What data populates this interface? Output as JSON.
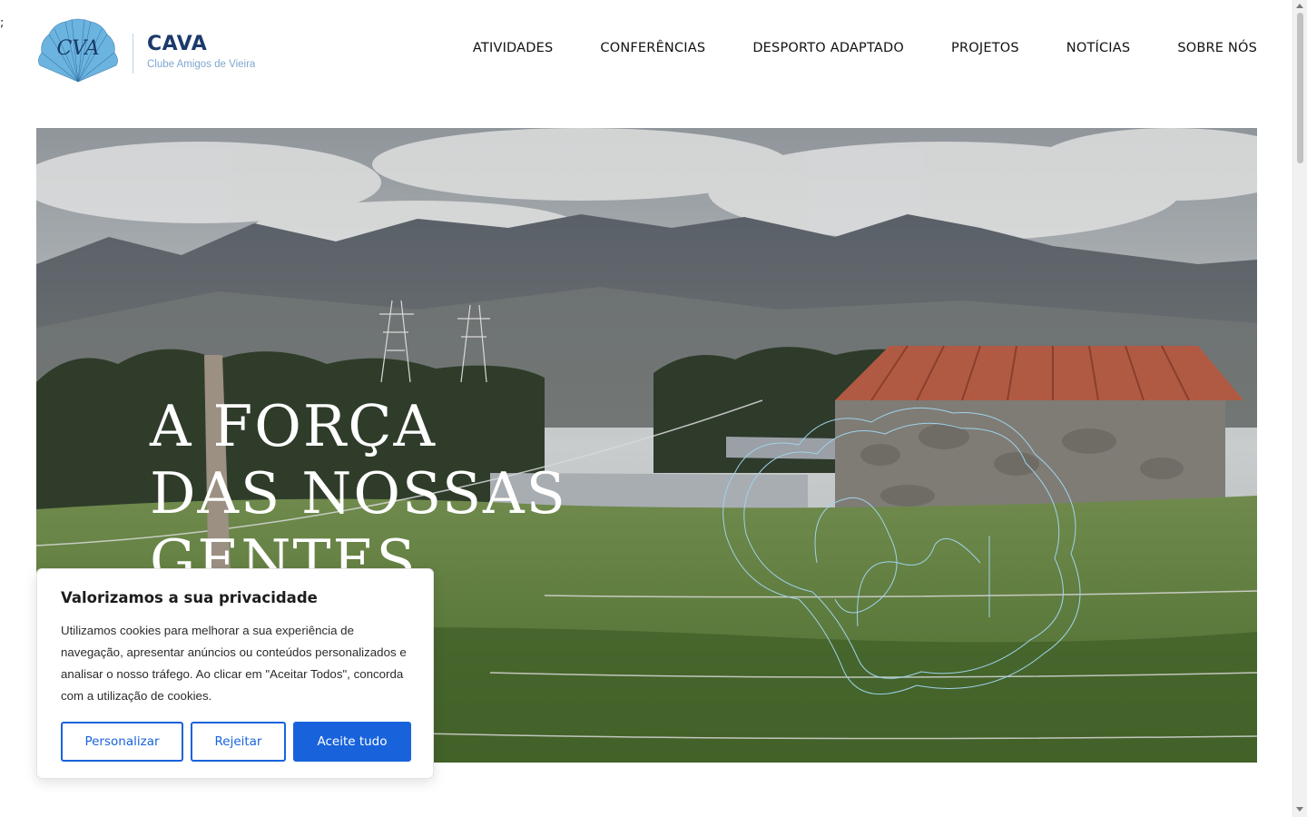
{
  "stray_text": ";",
  "brand": {
    "title": "CAVA",
    "subtitle": "Clube Amigos de Vieira",
    "logo_icon": "shell-logo-icon"
  },
  "nav": {
    "items": [
      {
        "label": "ATIVIDADES"
      },
      {
        "label": "CONFERÊNCIAS"
      },
      {
        "label": "DESPORTO ADAPTADO"
      },
      {
        "label": "PROJETOS"
      },
      {
        "label": "NOTÍCIAS"
      },
      {
        "label": "SOBRE NÓS"
      }
    ]
  },
  "hero": {
    "headline_lines": [
      "A FORÇA",
      "DAS NOSSAS",
      "GENTES"
    ]
  },
  "cookie_banner": {
    "title": "Valorizamos a sua privacidade",
    "text": "Utilizamos cookies para melhorar a sua experiência de navegação, apresentar anúncios ou conteúdos personalizados e analisar o nosso tráfego. Ao clicar em \"Aceitar Todos\", concorda com a utilização de cookies.",
    "buttons": {
      "customize": "Personalizar",
      "reject": "Rejeitar",
      "accept": "Aceite tudo"
    }
  },
  "colors": {
    "brand_dark": "#1b3a6b",
    "brand_light": "#7fa7cf",
    "accent_blue": "#1863dc",
    "logo_fill": "#6cb4e0"
  }
}
